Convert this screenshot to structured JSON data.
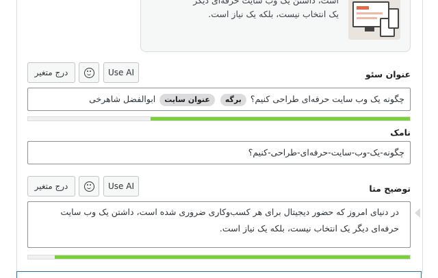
{
  "preview": {
    "text_line1": "است، داشتن یک وب سایت حرفه‌ای دیگر",
    "text_line2": "یک انتخاب نیست، بلکه یک نیاز است."
  },
  "seo_title": {
    "label": "عنوان سئو",
    "use_ai_label": "Use AI",
    "insert_variable_label": "درج متغیر",
    "text": "چگونه یک وب سایت حرفه‌ای طراحی کنیم؟",
    "pill_page": "برگه",
    "pill_site_title": "عنوان سایت",
    "author": "ابوالفضل شاهرخی",
    "progress": 0.68
  },
  "slug": {
    "label": "نامک",
    "value": "چگونه-یک-وب-سایت-حرفه‌ای-طراحی-کنیم؟"
  },
  "meta_description": {
    "label": "توضیح متا",
    "use_ai_label": "Use AI",
    "insert_variable_label": "درج متغیر",
    "line1": "در دنیای امروز که حضور دیجیتال برای هر کسب‌وکاری ضروری شده است، داشتن یک وب سایت",
    "line2": "حرفه‌ای دیگر یک انتخاب نیست، بلکه یک نیاز است.",
    "progress": 0.93
  },
  "colors": {
    "progress_good": "#7ad03a",
    "focus_blue": "#2271b1"
  },
  "icons": [
    "emoji-smile-icon",
    "emoji-smile-icon"
  ]
}
